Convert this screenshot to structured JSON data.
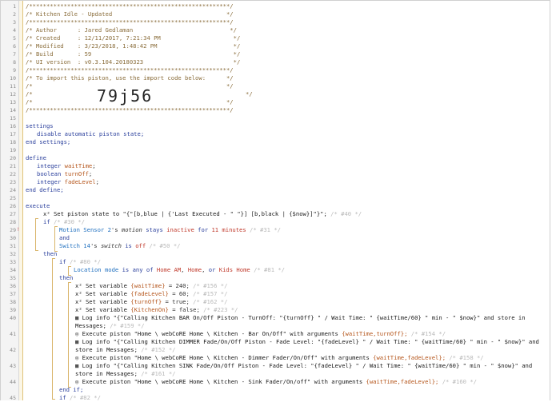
{
  "header": {
    "l1": "/**********************************************************/",
    "l2": "/* Kitchen Idle - Updated                                 */",
    "l3": "/**********************************************************/",
    "l4": "/* Author      : Jared Gedlaman                            */",
    "l5": "/* Created     : 12/11/2017, 7:21:34 PM                     */",
    "l6": "/* Modified    : 3/23/2018, 1:48:42 PM                      */",
    "l7": "/* Build       : 59                                         */",
    "l8": "/* UI version  : v0.3.104.20180323                          */",
    "l9": "/**********************************************************/",
    "l10": "/* To import this piston, use the import code below:      */",
    "l11": "/*                                                        */",
    "l12a": "/*",
    "l12b": "*/",
    "import_code": "79j56",
    "l13": "/*                                                        */",
    "l14": "/**********************************************************/"
  },
  "line_numbers": [
    "1",
    "2",
    "3",
    "4",
    "5",
    "6",
    "7",
    "8",
    "9",
    "10",
    "11",
    "12",
    "13",
    "14",
    "15",
    "16",
    "17",
    "18",
    "19",
    "20",
    "21",
    "22",
    "23",
    "24",
    "25",
    "26",
    "27",
    "28",
    "29",
    "30",
    "31",
    "32",
    "33",
    "34",
    "35",
    "36",
    "37",
    "38",
    "39",
    "40",
    "",
    "41",
    "",
    "42",
    "",
    "43",
    "",
    "44",
    "",
    "45",
    "46",
    "47"
  ],
  "settings": {
    "kw": "settings",
    "disable": "disable automatic piston state;",
    "end": "end settings;"
  },
  "define": {
    "kw": "define",
    "v1_type": "integer",
    "v1_name": "waitTime",
    "v2_type": "boolean",
    "v2_name": "turnOff",
    "v3_type": "integer",
    "v3_name": "fadeLevel",
    "end": "end define;"
  },
  "execute": {
    "kw": "execute",
    "state_a": "x² Set piston state to \"{\"[b,blue | {'Last Executed - \" \"}] [b,black | {$now}]\"}\";",
    "state_id": "/* #40 */",
    "if1": "if",
    "if1_id": "/* #30 */",
    "c1_dev": "Motion Sensor 2",
    "c1_mid": "'s",
    "c1_attr": "motion",
    "c1_op": "stays",
    "c1_val": "inactive",
    "c1_for": "for",
    "c1_dur": "11 minutes",
    "c1_id": "/* #31 */",
    "and": "and",
    "c2_dev": "Switch 14",
    "c2_mid": "'s",
    "c2_attr": "switch",
    "c2_op": "is",
    "c2_val": "off",
    "c2_id": "/* #50 */",
    "then1": "then",
    "if2": "if",
    "if2_id": "/* #80 */",
    "c3_a": "Location mode",
    "c3_op": "is any of",
    "c3_v1": "Home AM",
    "c3_v2": "Home",
    "c3_or": "or",
    "c3_v3": "Kids Home",
    "c3_id": "/* #81 */",
    "then2": "then",
    "s1": "x² Set variable",
    "s1_var": "{waitTime}",
    "s1_rest": "= 240;",
    "s1_id": "/* #156 */",
    "s2": "x² Set variable",
    "s2_var": "{fadeLevel}",
    "s2_rest": "= 60;",
    "s2_id": "/* #157 */",
    "s3": "x² Set variable",
    "s3_var": "{turnOff}",
    "s3_rest": "= true;",
    "s3_id": "/* #162 */",
    "s4": "x² Set variable",
    "s4_var": "{KitchenOn}",
    "s4_rest": "= false;",
    "s4_id": "/* #223 */",
    "log1a": "Log info \"{\"Calling Kitchen BAR On/Off Piston - TurnOff: \"{turnOff} \" / Wait Time: \" {waitTime/60} \" min - \" $now}\" and store in",
    "log1b": "Messages;",
    "log1_id": "/* #159 */",
    "ex1": "Execute piston \"Home \\ webCoRE Home \\ Kitchen - Bar On/Off\" with arguments",
    "ex1_args": "{waitTime,turnOff};",
    "ex1_id": "/* #154 */",
    "log2a": "Log info \"{\"Calling Kitchen DIMMER Fade/On/Off Piston - Fade Level: \"{fadeLevel} \" / Wait Time: \" {waitTime/60} \" min - \" $now}\" and",
    "log2b": "store in Messages;",
    "log2_id": "/* #152 */",
    "ex2": "Execute piston \"Home \\ webCoRE Home \\ Kitchen - Dimmer Fader/On/Off\" with arguments",
    "ex2_args": "{waitTime,fadeLevel};",
    "ex2_id": "/* #158 */",
    "log3a": "Log info \"{\"Calling Kitchen SINK Fade/On/Off Piston - Fade Level: \"{fadeLevel} \" / Wait Time: \" {waitTime/60} \" min - \" $now}\" and",
    "log3b": "store in Messages;",
    "log3_id": "/* #161 */",
    "ex3": "Execute piston \"Home \\ webCoRE Home \\ Kitchen - Sink Fader/On/off\" with arguments",
    "ex3_args": "{waitTime,fadeLevel};",
    "ex3_id": "/* #160 */",
    "endif": "end if;",
    "if3": "if",
    "if3_id": "/* #82 */"
  },
  "colors": {
    "comment": "#8a6d3b",
    "keyword": "#2a3f9c",
    "variable": "#b5561c",
    "device": "#1f6fbf"
  }
}
